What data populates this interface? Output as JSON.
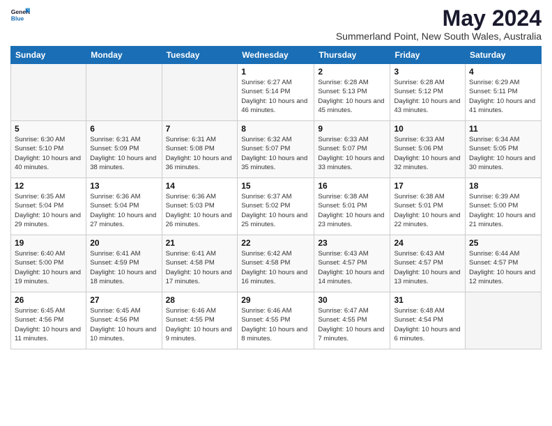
{
  "header": {
    "logo_line1": "General",
    "logo_line2": "Blue",
    "title": "May 2024",
    "subtitle": "Summerland Point, New South Wales, Australia"
  },
  "days_of_week": [
    "Sunday",
    "Monday",
    "Tuesday",
    "Wednesday",
    "Thursday",
    "Friday",
    "Saturday"
  ],
  "weeks": [
    [
      {
        "day": "",
        "empty": true
      },
      {
        "day": "",
        "empty": true
      },
      {
        "day": "",
        "empty": true
      },
      {
        "day": "1",
        "sunrise": "6:27 AM",
        "sunset": "5:14 PM",
        "daylight": "10 hours and 46 minutes."
      },
      {
        "day": "2",
        "sunrise": "6:28 AM",
        "sunset": "5:13 PM",
        "daylight": "10 hours and 45 minutes."
      },
      {
        "day": "3",
        "sunrise": "6:28 AM",
        "sunset": "5:12 PM",
        "daylight": "10 hours and 43 minutes."
      },
      {
        "day": "4",
        "sunrise": "6:29 AM",
        "sunset": "5:11 PM",
        "daylight": "10 hours and 41 minutes."
      }
    ],
    [
      {
        "day": "5",
        "sunrise": "6:30 AM",
        "sunset": "5:10 PM",
        "daylight": "10 hours and 40 minutes."
      },
      {
        "day": "6",
        "sunrise": "6:31 AM",
        "sunset": "5:09 PM",
        "daylight": "10 hours and 38 minutes."
      },
      {
        "day": "7",
        "sunrise": "6:31 AM",
        "sunset": "5:08 PM",
        "daylight": "10 hours and 36 minutes."
      },
      {
        "day": "8",
        "sunrise": "6:32 AM",
        "sunset": "5:07 PM",
        "daylight": "10 hours and 35 minutes."
      },
      {
        "day": "9",
        "sunrise": "6:33 AM",
        "sunset": "5:07 PM",
        "daylight": "10 hours and 33 minutes."
      },
      {
        "day": "10",
        "sunrise": "6:33 AM",
        "sunset": "5:06 PM",
        "daylight": "10 hours and 32 minutes."
      },
      {
        "day": "11",
        "sunrise": "6:34 AM",
        "sunset": "5:05 PM",
        "daylight": "10 hours and 30 minutes."
      }
    ],
    [
      {
        "day": "12",
        "sunrise": "6:35 AM",
        "sunset": "5:04 PM",
        "daylight": "10 hours and 29 minutes."
      },
      {
        "day": "13",
        "sunrise": "6:36 AM",
        "sunset": "5:04 PM",
        "daylight": "10 hours and 27 minutes."
      },
      {
        "day": "14",
        "sunrise": "6:36 AM",
        "sunset": "5:03 PM",
        "daylight": "10 hours and 26 minutes."
      },
      {
        "day": "15",
        "sunrise": "6:37 AM",
        "sunset": "5:02 PM",
        "daylight": "10 hours and 25 minutes."
      },
      {
        "day": "16",
        "sunrise": "6:38 AM",
        "sunset": "5:01 PM",
        "daylight": "10 hours and 23 minutes."
      },
      {
        "day": "17",
        "sunrise": "6:38 AM",
        "sunset": "5:01 PM",
        "daylight": "10 hours and 22 minutes."
      },
      {
        "day": "18",
        "sunrise": "6:39 AM",
        "sunset": "5:00 PM",
        "daylight": "10 hours and 21 minutes."
      }
    ],
    [
      {
        "day": "19",
        "sunrise": "6:40 AM",
        "sunset": "5:00 PM",
        "daylight": "10 hours and 19 minutes."
      },
      {
        "day": "20",
        "sunrise": "6:41 AM",
        "sunset": "4:59 PM",
        "daylight": "10 hours and 18 minutes."
      },
      {
        "day": "21",
        "sunrise": "6:41 AM",
        "sunset": "4:58 PM",
        "daylight": "10 hours and 17 minutes."
      },
      {
        "day": "22",
        "sunrise": "6:42 AM",
        "sunset": "4:58 PM",
        "daylight": "10 hours and 16 minutes."
      },
      {
        "day": "23",
        "sunrise": "6:43 AM",
        "sunset": "4:57 PM",
        "daylight": "10 hours and 14 minutes."
      },
      {
        "day": "24",
        "sunrise": "6:43 AM",
        "sunset": "4:57 PM",
        "daylight": "10 hours and 13 minutes."
      },
      {
        "day": "25",
        "sunrise": "6:44 AM",
        "sunset": "4:57 PM",
        "daylight": "10 hours and 12 minutes."
      }
    ],
    [
      {
        "day": "26",
        "sunrise": "6:45 AM",
        "sunset": "4:56 PM",
        "daylight": "10 hours and 11 minutes."
      },
      {
        "day": "27",
        "sunrise": "6:45 AM",
        "sunset": "4:56 PM",
        "daylight": "10 hours and 10 minutes."
      },
      {
        "day": "28",
        "sunrise": "6:46 AM",
        "sunset": "4:55 PM",
        "daylight": "10 hours and 9 minutes."
      },
      {
        "day": "29",
        "sunrise": "6:46 AM",
        "sunset": "4:55 PM",
        "daylight": "10 hours and 8 minutes."
      },
      {
        "day": "30",
        "sunrise": "6:47 AM",
        "sunset": "4:55 PM",
        "daylight": "10 hours and 7 minutes."
      },
      {
        "day": "31",
        "sunrise": "6:48 AM",
        "sunset": "4:54 PM",
        "daylight": "10 hours and 6 minutes."
      },
      {
        "day": "",
        "empty": true
      }
    ]
  ]
}
